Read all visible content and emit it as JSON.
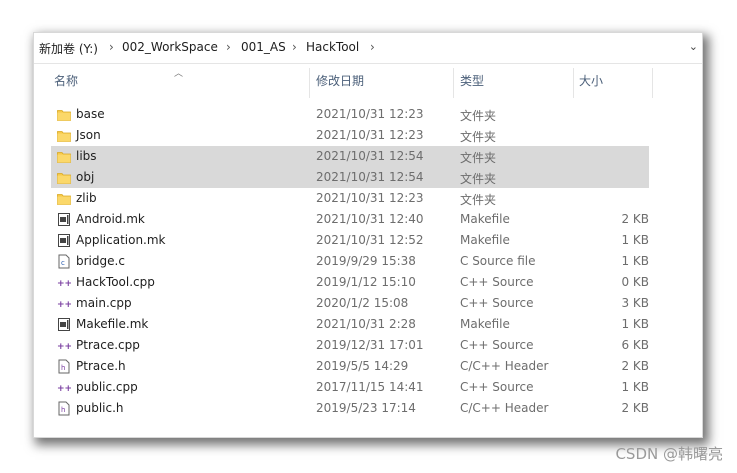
{
  "breadcrumb": {
    "items": [
      "新加卷 (Y:)",
      "002_WorkSpace",
      "001_AS",
      "HackTool"
    ],
    "separator": "›",
    "dropdown": "⌄"
  },
  "columns": {
    "name": "名称",
    "date": "修改日期",
    "type": "类型",
    "size": "大小"
  },
  "files": [
    {
      "name": "base",
      "date": "2021/10/31 12:23",
      "type": "文件夹",
      "size": "",
      "icon": "folder-icon",
      "selected": false
    },
    {
      "name": "Json",
      "date": "2021/10/31 12:23",
      "type": "文件夹",
      "size": "",
      "icon": "folder-icon",
      "selected": false
    },
    {
      "name": "libs",
      "date": "2021/10/31 12:54",
      "type": "文件夹",
      "size": "",
      "icon": "folder-icon",
      "selected": true
    },
    {
      "name": "obj",
      "date": "2021/10/31 12:54",
      "type": "文件夹",
      "size": "",
      "icon": "folder-icon",
      "selected": true
    },
    {
      "name": "zlib",
      "date": "2021/10/31 12:23",
      "type": "文件夹",
      "size": "",
      "icon": "folder-icon",
      "selected": false
    },
    {
      "name": "Android.mk",
      "date": "2021/10/31 12:40",
      "type": "Makefile",
      "size": "2 KB",
      "icon": "makefile-icon",
      "selected": false
    },
    {
      "name": "Application.mk",
      "date": "2021/10/31 12:52",
      "type": "Makefile",
      "size": "1 KB",
      "icon": "makefile-icon",
      "selected": false
    },
    {
      "name": "bridge.c",
      "date": "2019/9/29 15:38",
      "type": "C Source file",
      "size": "1 KB",
      "icon": "c-file-icon",
      "selected": false
    },
    {
      "name": "HackTool.cpp",
      "date": "2019/1/12 15:10",
      "type": "C++ Source",
      "size": "0 KB",
      "icon": "cpp-file-icon",
      "selected": false
    },
    {
      "name": "main.cpp",
      "date": "2020/1/2 15:08",
      "type": "C++ Source",
      "size": "3 KB",
      "icon": "cpp-file-icon",
      "selected": false
    },
    {
      "name": "Makefile.mk",
      "date": "2021/10/31 2:28",
      "type": "Makefile",
      "size": "1 KB",
      "icon": "makefile-icon",
      "selected": false
    },
    {
      "name": "Ptrace.cpp",
      "date": "2019/12/31 17:01",
      "type": "C++ Source",
      "size": "6 KB",
      "icon": "cpp-file-icon",
      "selected": false
    },
    {
      "name": "Ptrace.h",
      "date": "2019/5/5 14:29",
      "type": "C/C++ Header",
      "size": "2 KB",
      "icon": "h-file-icon",
      "selected": false
    },
    {
      "name": "public.cpp",
      "date": "2017/11/15 14:41",
      "type": "C++ Source",
      "size": "1 KB",
      "icon": "cpp-file-icon",
      "selected": false
    },
    {
      "name": "public.h",
      "date": "2019/5/23 17:14",
      "type": "C/C++ Header",
      "size": "2 KB",
      "icon": "h-file-icon",
      "selected": false
    }
  ],
  "watermark": "CSDN @韩曙亮",
  "colors": {
    "folder": "#f7c948",
    "selected_row": "#d9d9d9",
    "header_text": "#4c607a",
    "cpp_icon": "#7a3fa0"
  }
}
